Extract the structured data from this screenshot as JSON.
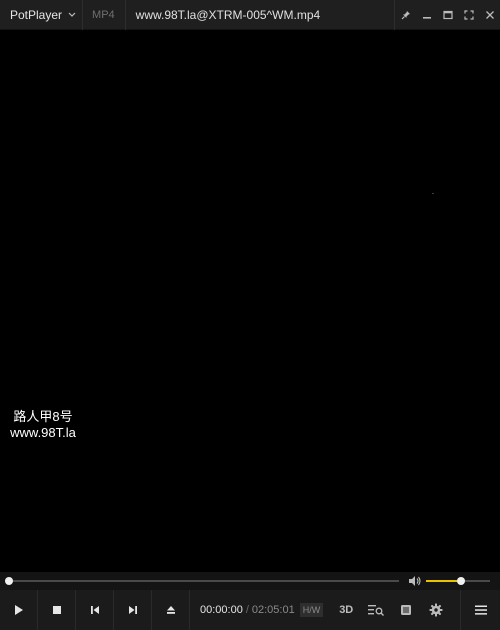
{
  "titlebar": {
    "app_name": "PotPlayer",
    "format": "MP4",
    "file_title": "www.98T.la@XTRM-005^WM.mp4",
    "controls": [
      "pin-icon",
      "minimize-icon",
      "maximize-icon",
      "fullscreen-icon",
      "close-icon"
    ]
  },
  "video": {
    "watermark_line1": "路人甲8号",
    "watermark_line2": "www.98T.la"
  },
  "seek": {
    "progress": 0.0
  },
  "volume": {
    "level": 0.55,
    "accent": "#e6c200"
  },
  "time": {
    "current": "00:00:00",
    "separator": "/",
    "total": "02:05:01",
    "decoder_badge": "H/W"
  },
  "controls": {
    "buttons": [
      "play-icon",
      "stop-icon",
      "previous-icon",
      "next-icon",
      "eject-icon"
    ],
    "label_3d": "3D",
    "right_icons": [
      "3d-icon",
      "video-search-icon",
      "playlist-icon",
      "settings-icon",
      "menu-icon"
    ]
  },
  "colors": {
    "background": "#000000",
    "bar": "#1b1b1b",
    "accent": "#e6c200"
  }
}
